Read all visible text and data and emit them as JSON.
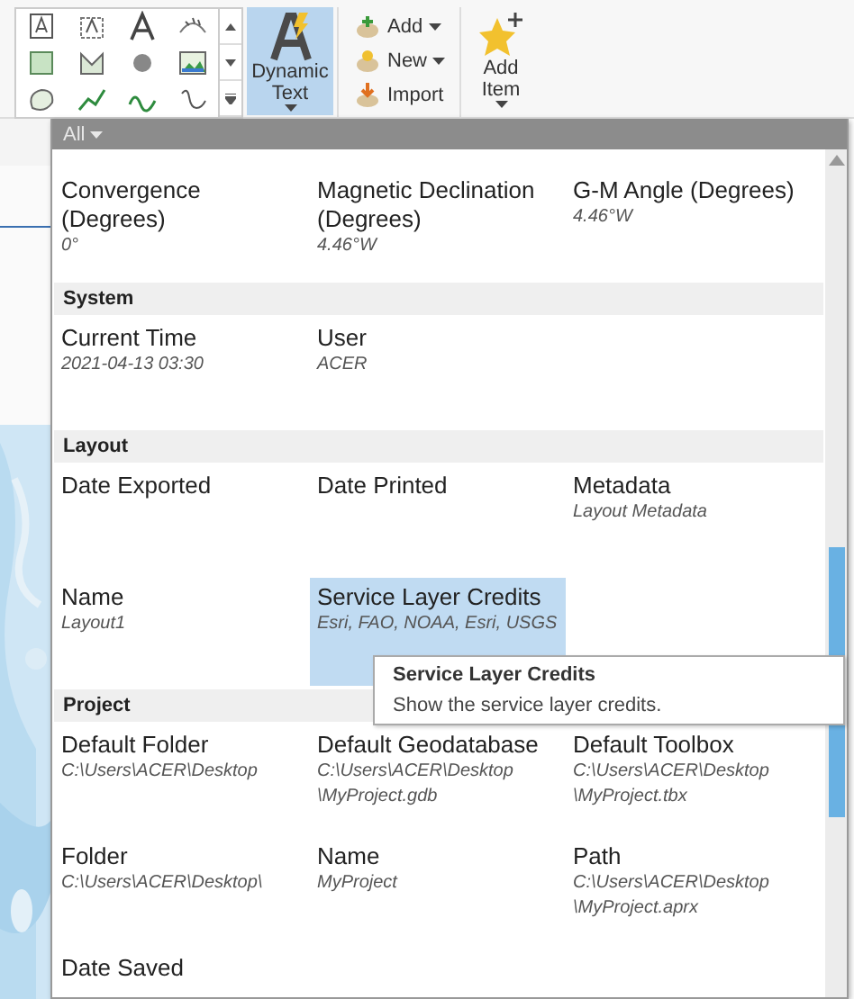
{
  "ribbon": {
    "gallery": {
      "items": [
        {
          "kind": "text"
        },
        {
          "kind": "framed-text"
        },
        {
          "kind": "letter"
        },
        {
          "kind": "curved-text"
        },
        {
          "kind": "rectangle"
        },
        {
          "kind": "polygon"
        },
        {
          "kind": "circle"
        },
        {
          "kind": "picture"
        },
        {
          "kind": "lasso"
        },
        {
          "kind": "line"
        },
        {
          "kind": "curve"
        },
        {
          "kind": "freehand"
        }
      ]
    },
    "dynamic_text": {
      "label": "Dynamic Text",
      "selected": true
    },
    "commands": [
      {
        "label": "Add"
      },
      {
        "label": "New"
      },
      {
        "label": "Import"
      }
    ],
    "add_item": {
      "label": "Add Item"
    }
  },
  "panel": {
    "filter": "All",
    "sections": [
      {
        "items": [
          {
            "name": "Convergence (Degrees)",
            "value": "0°",
            "selected": false
          },
          {
            "name": "Magnetic Declination (Degrees)",
            "value": "4.46°W",
            "selected": false
          },
          {
            "name": "G-M Angle (Degrees)",
            "value": "4.46°W",
            "selected": false
          }
        ]
      },
      {
        "title": "System",
        "items": [
          {
            "name": "Current Time",
            "value": "2021-04-13 03:30",
            "selected": false
          },
          {
            "name": "User",
            "value": "ACER",
            "selected": false
          }
        ]
      },
      {
        "title": "Layout",
        "items": [
          {
            "name": "Date Exported",
            "selected": false
          },
          {
            "name": "Date Printed",
            "selected": false
          },
          {
            "name": "Metadata",
            "value": "Layout Metadata",
            "selected": false
          },
          {
            "name": "Name",
            "value": "Layout1",
            "selected": false
          },
          {
            "name": "Service Layer Credits",
            "value": "Esri, FAO, NOAA, Esri, USGS",
            "selected": true
          }
        ]
      },
      {
        "title": "Project",
        "items": [
          {
            "name": "Default Folder",
            "value": "C:\\Users\\ACER\\Desktop",
            "selected": false
          },
          {
            "name": "Default Geodatabase",
            "value": "C:\\Users\\ACER\\Desktop \\MyProject.gdb",
            "selected": false
          },
          {
            "name": "Default Toolbox",
            "value": "C:\\Users\\ACER\\Desktop \\MyProject.tbx",
            "selected": false
          },
          {
            "name": "Folder",
            "value": "C:\\Users\\ACER\\Desktop\\",
            "selected": false
          },
          {
            "name": "Name",
            "value": "MyProject",
            "selected": false
          },
          {
            "name": "Path",
            "value": "C:\\Users\\ACER\\Desktop \\MyProject.aprx",
            "selected": false
          },
          {
            "name": "Date Saved",
            "selected": false
          }
        ]
      }
    ]
  },
  "tooltip": {
    "title": "Service Layer Credits",
    "text": "Show the service layer credits."
  }
}
